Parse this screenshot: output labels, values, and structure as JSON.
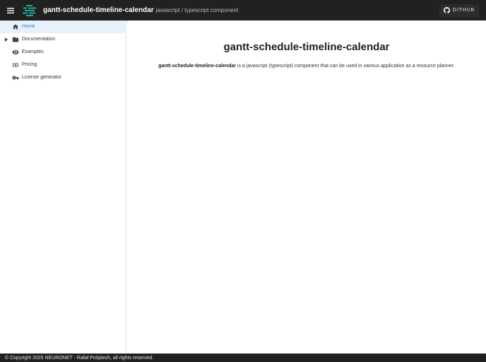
{
  "header": {
    "title": "gantt-schedule-timeline-calendar",
    "subtitle": "javascript / typescript component",
    "menu_icon": "menu-icon",
    "logo_icon": "gantt-logo-icon",
    "github_label": "GITHUB",
    "github_icon": "github-icon"
  },
  "sidebar": {
    "items": [
      {
        "label": "Home",
        "icon": "home-icon",
        "active": true
      },
      {
        "label": "Documentation",
        "icon": "folder-icon",
        "expandable": true
      },
      {
        "label": "Examples",
        "icon": "eye-icon"
      },
      {
        "label": "Pricing",
        "icon": "cash-icon"
      },
      {
        "label": "License generator",
        "icon": "key-icon"
      }
    ]
  },
  "main": {
    "title": "gantt-schedule-timeline-calendar",
    "description_strong": "gantt-schedule-timeline-calendar",
    "description_rest": " is a javascript (typescript) component that can be used in various application as a resource planner."
  },
  "footer": {
    "text": "© Copyright 2025 NEURONET - Rafał Pośpiech, all rights reserved."
  },
  "colors": {
    "topbar": "#212121",
    "accent": "#1e88e5",
    "active_bg": "#e8f1fb",
    "logo_green": "#26a69a"
  }
}
